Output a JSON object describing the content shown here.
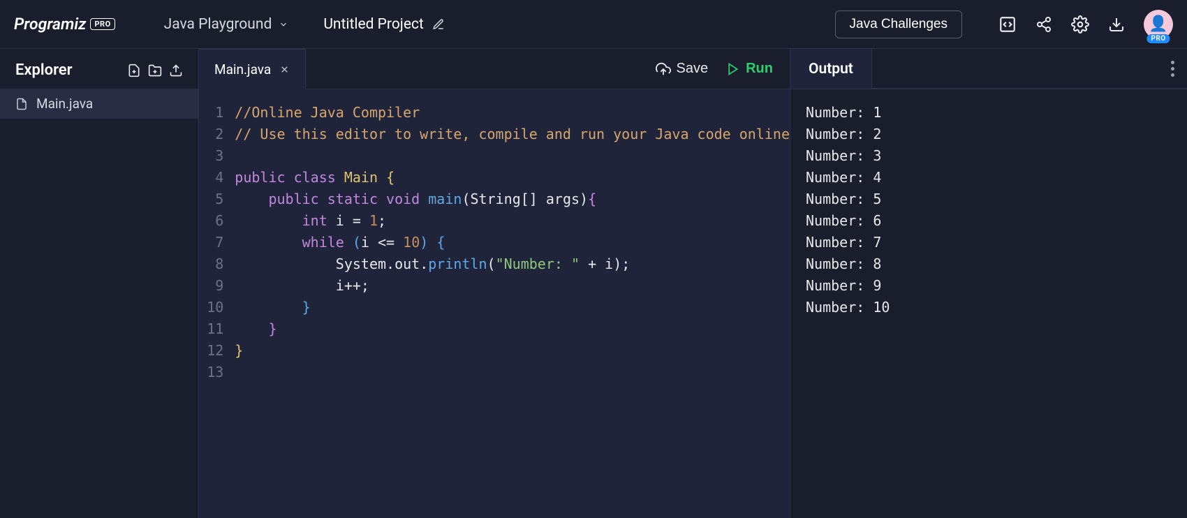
{
  "header": {
    "brand": "Programiz",
    "brand_badge": "PRO",
    "playground_label": "Java Playground",
    "project_name": "Untitled Project",
    "challenges_label": "Java Challenges",
    "avatar_badge": "PRO"
  },
  "sidebar": {
    "title": "Explorer",
    "files": [
      "Main.java"
    ]
  },
  "editor": {
    "tab_label": "Main.java",
    "save_label": "Save",
    "run_label": "Run",
    "line_count": 13,
    "code_plain": "//Online Java Compiler\n// Use this editor to write, compile and run your Java code online\n\npublic class Main {\n    public static void main(String[] args){\n        int i = 1;\n        while (i <= 10) {\n            System.out.println(\"Number: \" + i);\n            i++;\n        }\n    }\n}"
  },
  "output": {
    "title": "Output",
    "lines": [
      "Number: 1",
      "Number: 2",
      "Number: 3",
      "Number: 4",
      "Number: 5",
      "Number: 6",
      "Number: 7",
      "Number: 8",
      "Number: 9",
      "Number: 10"
    ]
  }
}
